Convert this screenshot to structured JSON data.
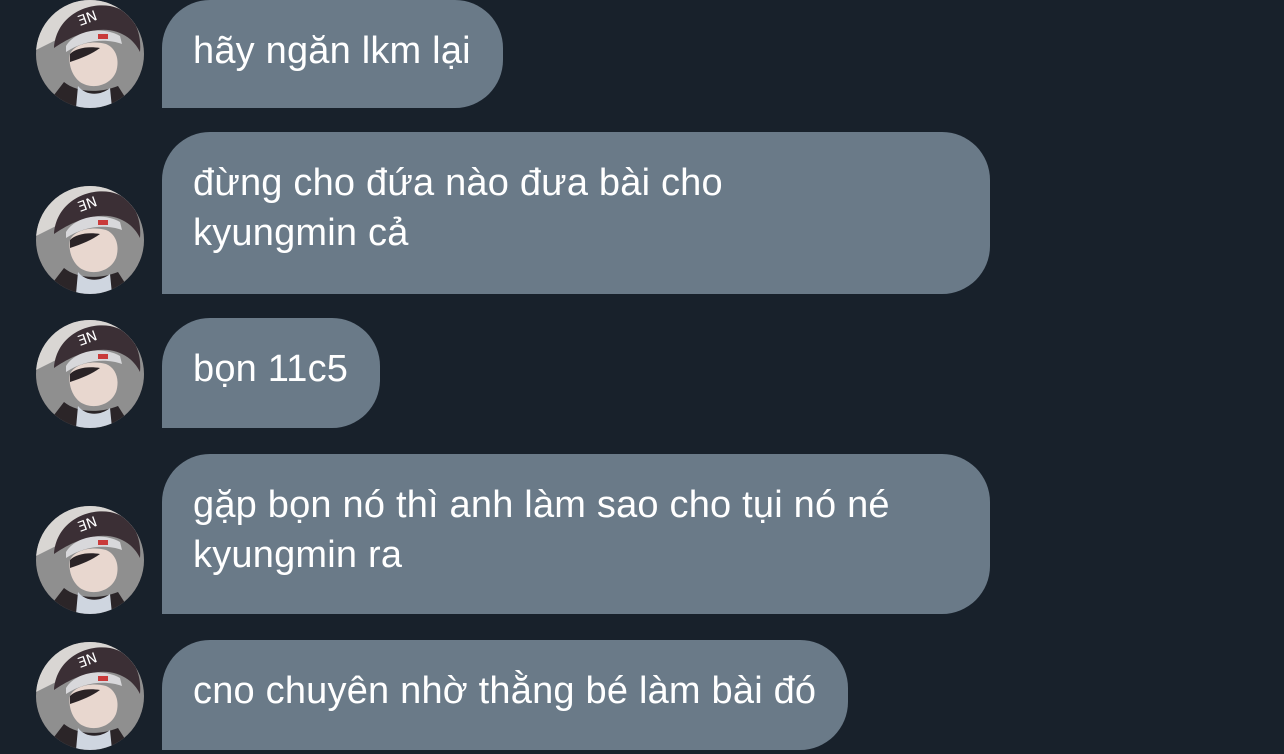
{
  "messages": [
    {
      "text": "hãy ngăn lkm lại"
    },
    {
      "text": "đừng cho đứa nào đưa bài cho kyungmin cả"
    },
    {
      "text": "bọn 11c5"
    },
    {
      "text": "gặp bọn nó thì anh làm sao cho tụi nó né kyungmin ra"
    },
    {
      "text": "cno chuyên nhờ thằng bé làm bài đó"
    }
  ],
  "colors": {
    "background": "#18212b",
    "bubble": "#6a7a88",
    "text": "#ffffff"
  }
}
